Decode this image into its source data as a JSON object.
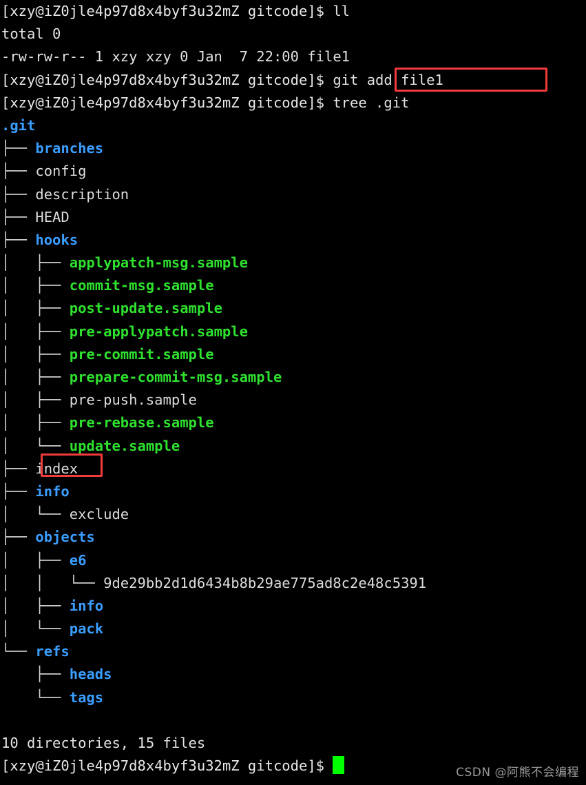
{
  "terminal": {
    "background_color": "#000000",
    "foreground_color": "#e2e2e2",
    "prompt": "[xzy@iZ0jle4p97d8x4byf3u32mZ gitcode]$ ",
    "colors": {
      "directory": "#3b9eff",
      "executable": "#2fe02f",
      "file": "#dcdcdc",
      "annotation": "#f23b3b",
      "cursor": "#00ff00",
      "watermark": "#9a9a9a"
    }
  },
  "session": {
    "cmd1": "ll",
    "ls_total": "total 0",
    "ls_entry": "-rw-rw-r-- 1 xzy xzy 0 Jan  7 22:00 file1",
    "cmd2": "git add file1",
    "cmd3": "tree .git",
    "tree_root": ".git",
    "summary": "10 directories, 15 files"
  },
  "tree": [
    {
      "prefix": "├── ",
      "name": "branches",
      "kind": "dir"
    },
    {
      "prefix": "├── ",
      "name": "config",
      "kind": "file"
    },
    {
      "prefix": "├── ",
      "name": "description",
      "kind": "file"
    },
    {
      "prefix": "├── ",
      "name": "HEAD",
      "kind": "file"
    },
    {
      "prefix": "├── ",
      "name": "hooks",
      "kind": "dir"
    },
    {
      "prefix": "│   ├── ",
      "name": "applypatch-msg.sample",
      "kind": "exec"
    },
    {
      "prefix": "│   ├── ",
      "name": "commit-msg.sample",
      "kind": "exec"
    },
    {
      "prefix": "│   ├── ",
      "name": "post-update.sample",
      "kind": "exec"
    },
    {
      "prefix": "│   ├── ",
      "name": "pre-applypatch.sample",
      "kind": "exec"
    },
    {
      "prefix": "│   ├── ",
      "name": "pre-commit.sample",
      "kind": "exec"
    },
    {
      "prefix": "│   ├── ",
      "name": "prepare-commit-msg.sample",
      "kind": "exec"
    },
    {
      "prefix": "│   ├── ",
      "name": "pre-push.sample",
      "kind": "file"
    },
    {
      "prefix": "│   ├── ",
      "name": "pre-rebase.sample",
      "kind": "exec"
    },
    {
      "prefix": "│   └── ",
      "name": "update.sample",
      "kind": "exec"
    },
    {
      "prefix": "├── ",
      "name": "index",
      "kind": "file"
    },
    {
      "prefix": "├── ",
      "name": "info",
      "kind": "dir"
    },
    {
      "prefix": "│   └── ",
      "name": "exclude",
      "kind": "file"
    },
    {
      "prefix": "├── ",
      "name": "objects",
      "kind": "dir"
    },
    {
      "prefix": "│   ├── ",
      "name": "e6",
      "kind": "dir"
    },
    {
      "prefix": "│   │   └── ",
      "name": "9de29bb2d1d6434b8b29ae775ad8c2e48c5391",
      "kind": "file"
    },
    {
      "prefix": "│   ├── ",
      "name": "info",
      "kind": "dir"
    },
    {
      "prefix": "│   └── ",
      "name": "pack",
      "kind": "dir"
    },
    {
      "prefix": "└── ",
      "name": "refs",
      "kind": "dir"
    },
    {
      "prefix": "    ├── ",
      "name": "heads",
      "kind": "dir"
    },
    {
      "prefix": "    └── ",
      "name": "tags",
      "kind": "dir"
    }
  ],
  "annotations": [
    {
      "label": "git add file1",
      "target": "cmd2"
    },
    {
      "label": "index",
      "target": "tree-index"
    }
  ],
  "watermark": {
    "text": "CSDN @阿熊不会编程"
  }
}
